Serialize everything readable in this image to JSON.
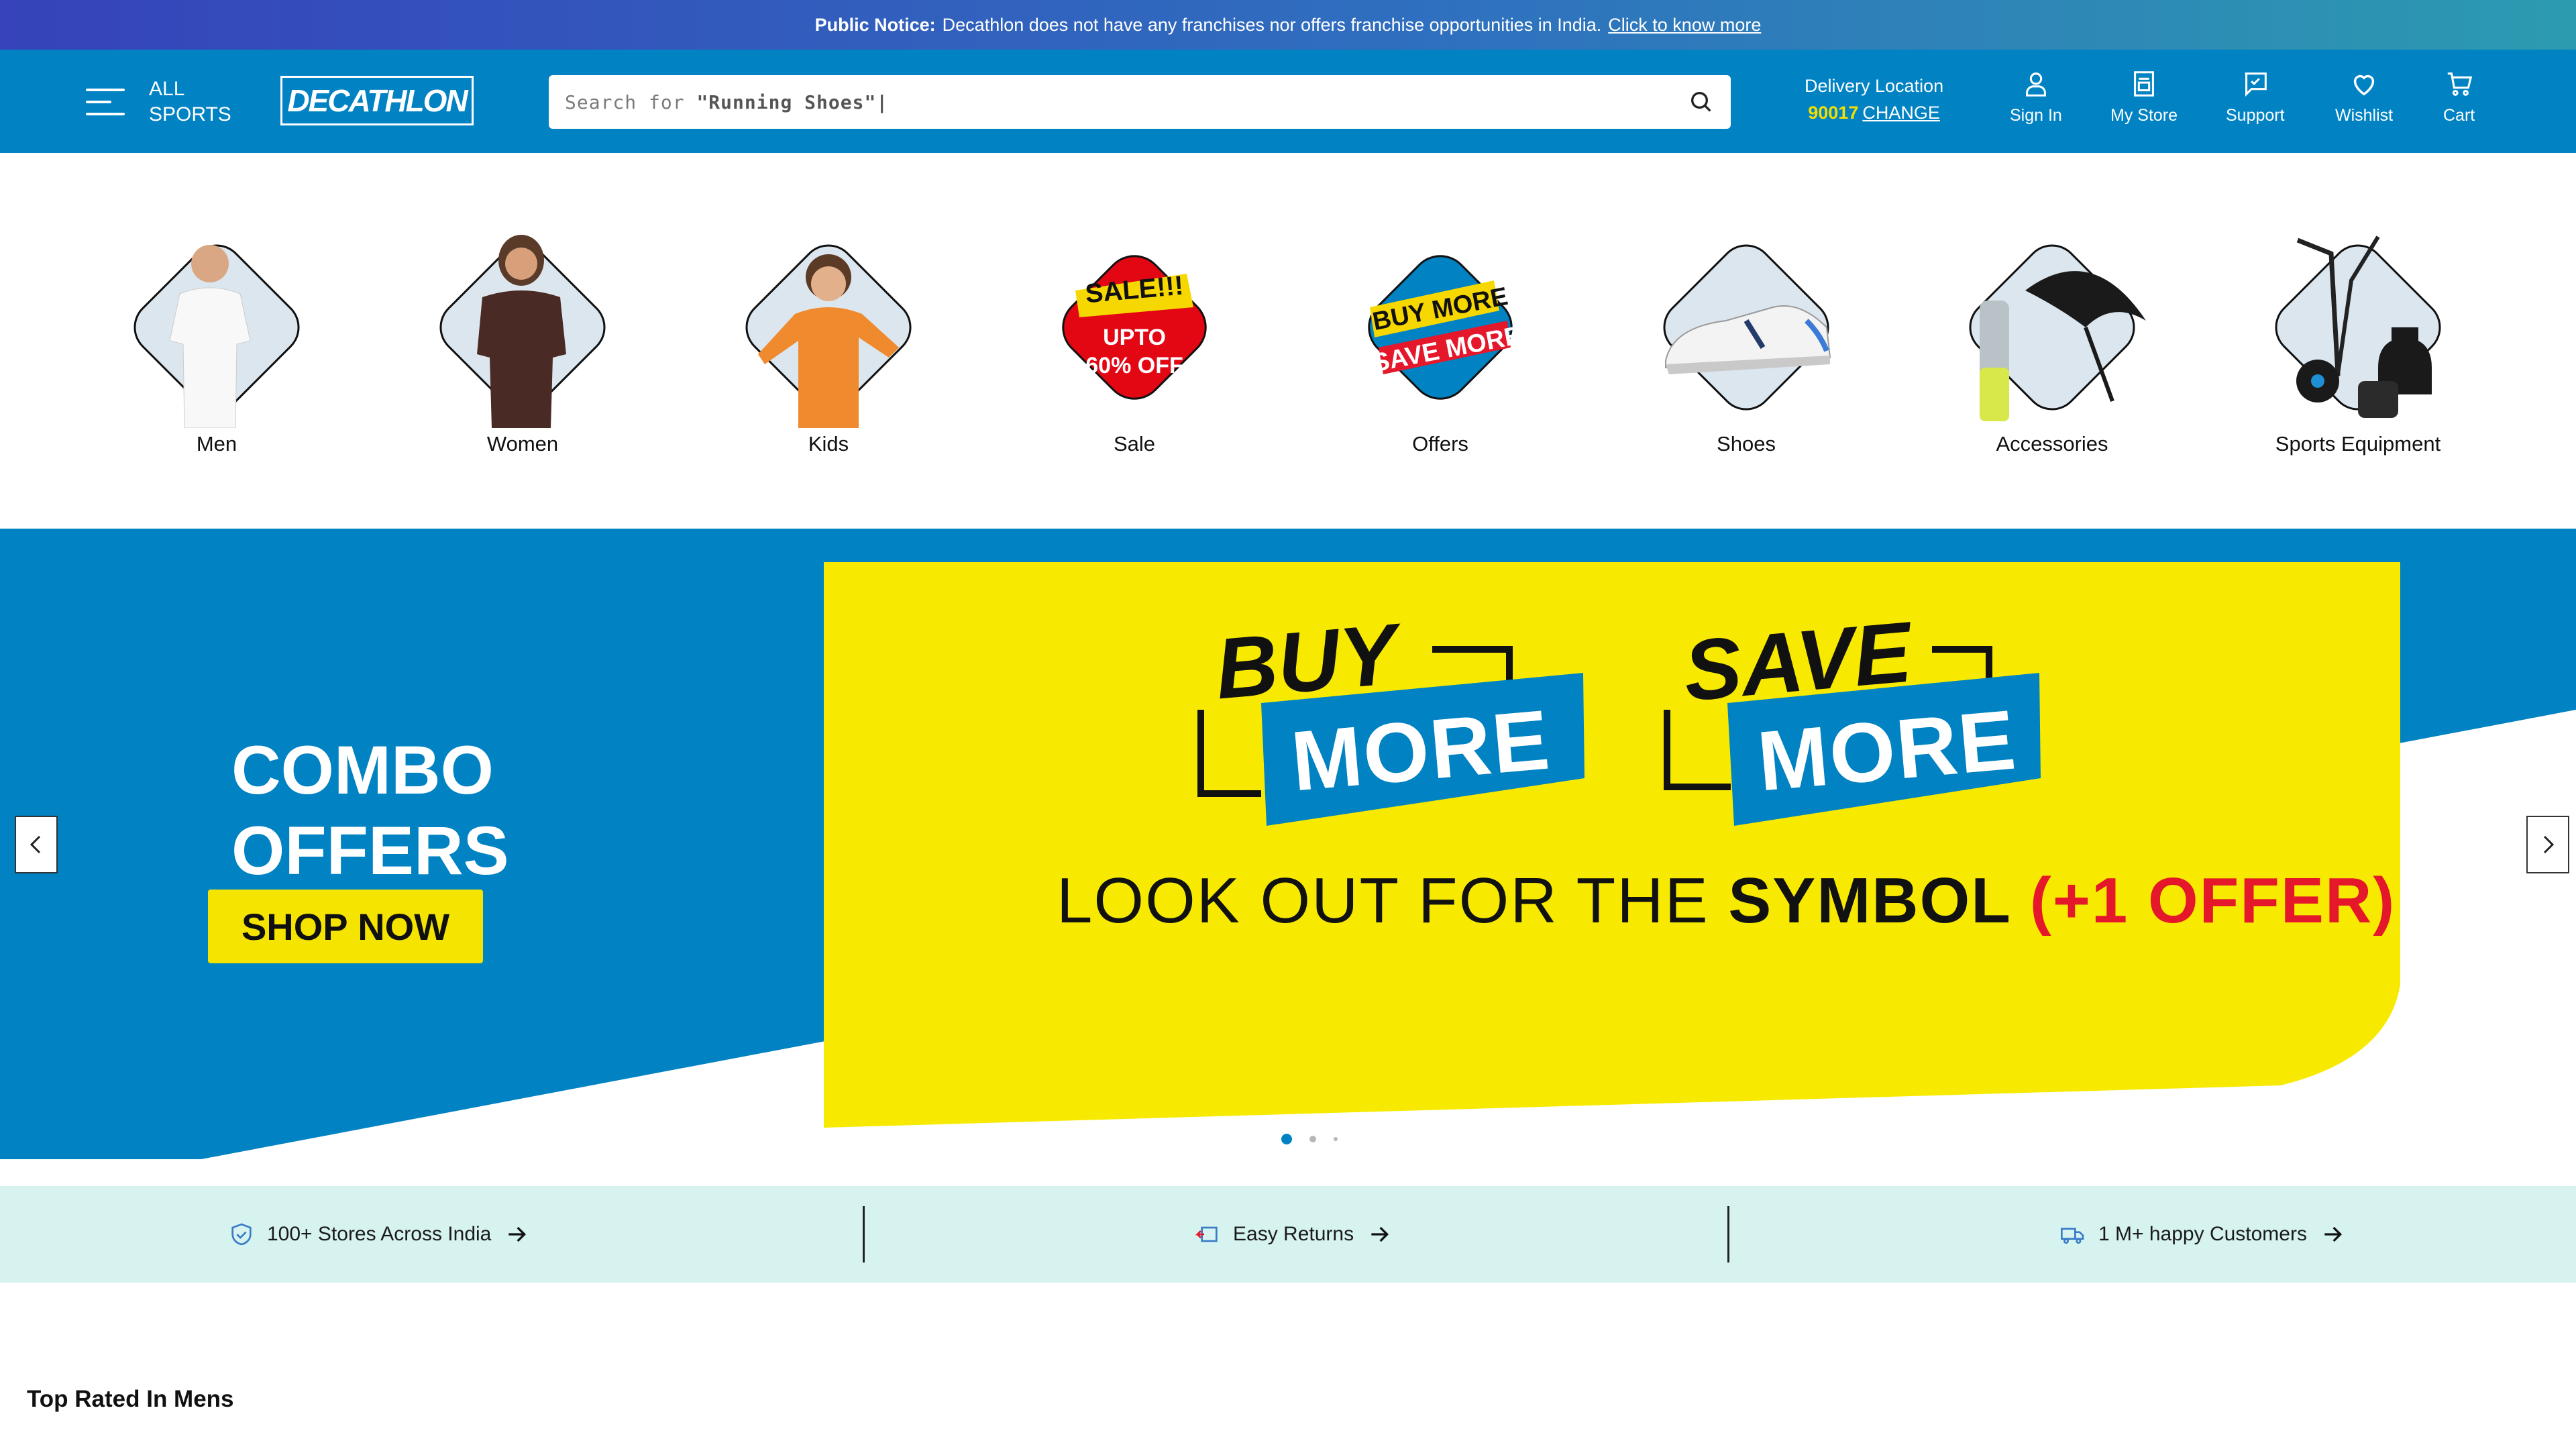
{
  "notice": {
    "label": "Public Notice:",
    "text": "Decathlon does not have any franchises nor offers franchise opportunities in India.",
    "link": "Click to know more"
  },
  "header": {
    "menu_line1": "ALL",
    "menu_line2": "SPORTS",
    "logo": "DECATHLON",
    "search_prefix": "Search for ",
    "search_term": "\"Running Shoes\"|",
    "delivery_label": "Delivery Location",
    "pincode": "90017",
    "change_label": "CHANGE",
    "nav": [
      "Sign In",
      "My Store",
      "Support",
      "Wishlist",
      "Cart"
    ],
    "brand_color": "#0082c3"
  },
  "categories": [
    {
      "label": "Men"
    },
    {
      "label": "Women"
    },
    {
      "label": "Kids"
    },
    {
      "label": "Sale",
      "badge_line1": "SALE!!!",
      "badge_line2": "UPTO",
      "badge_line3": "60% OFF"
    },
    {
      "label": "Offers",
      "badge_line1": "BUY MORE",
      "badge_line2": "SAVE MORE"
    },
    {
      "label": "Shoes"
    },
    {
      "label": "Accessories"
    },
    {
      "label": "Sports Equipment"
    }
  ],
  "hero": {
    "combo_line1": "COMBO",
    "combo_line2": "OFFERS",
    "shop_now": "SHOP NOW",
    "buy_word": "BUY",
    "more_word": "MORE",
    "save_word": "SAVE",
    "tag_prefix": "LOOK OUT FOR THE ",
    "tag_bold": "SYMBOL ",
    "tag_red": "(+1 OFFER)",
    "slide_count": 3,
    "active_slide": 1
  },
  "features": [
    {
      "label": "100+ Stores Across India",
      "icon": "shield-check-icon"
    },
    {
      "label": "Easy Returns",
      "icon": "return-box-icon"
    },
    {
      "label": "1 M+ happy Customers",
      "icon": "truck-icon"
    }
  ],
  "section": {
    "title": "Top Rated In Mens"
  }
}
